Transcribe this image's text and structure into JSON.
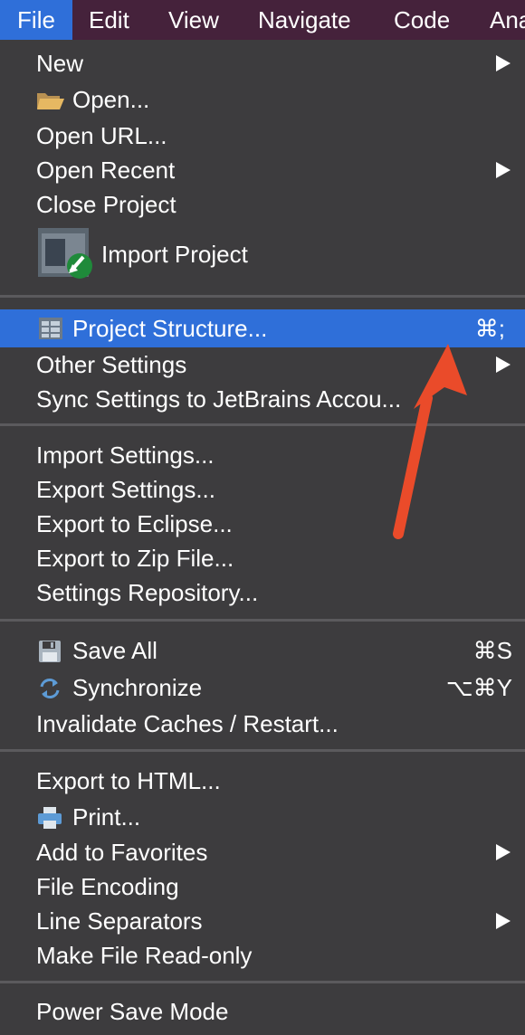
{
  "menubar": {
    "items": [
      {
        "label": "File"
      },
      {
        "label": "Edit"
      },
      {
        "label": "View"
      },
      {
        "label": "Navigate"
      },
      {
        "label": "Code"
      },
      {
        "label": "Ana"
      }
    ]
  },
  "file_menu": {
    "group1": {
      "new": "New",
      "open": "Open...",
      "open_url": "Open URL...",
      "open_recent": "Open Recent",
      "close_project": "Close Project",
      "import_project": "Import Project"
    },
    "group2": {
      "project_structure": "Project Structure...",
      "project_structure_shortcut": "⌘;",
      "other_settings": "Other Settings",
      "sync_settings": "Sync Settings to JetBrains Accou..."
    },
    "group3": {
      "import_settings": "Import Settings...",
      "export_settings": "Export Settings...",
      "export_eclipse": "Export to Eclipse...",
      "export_zip": "Export to Zip File...",
      "settings_repo": "Settings Repository..."
    },
    "group4": {
      "save_all": "Save All",
      "save_all_shortcut": "⌘S",
      "synchronize": "Synchronize",
      "synchronize_shortcut": "⌥⌘Y",
      "invalidate_caches": "Invalidate Caches / Restart..."
    },
    "group5": {
      "export_html": "Export to HTML...",
      "print": "Print...",
      "add_favorites": "Add to Favorites",
      "file_encoding": "File Encoding",
      "line_separators": "Line Separators",
      "read_only": "Make File Read-only"
    },
    "group6": {
      "power_save": "Power Save Mode"
    }
  },
  "colors": {
    "menubar_bg": "#45223b",
    "menu_bg": "#3d3c3e",
    "selection": "#2f6fd9",
    "annotation_arrow": "#ea4b2a"
  },
  "icons": [
    "folder-icon",
    "import-project-icon",
    "project-structure-icon",
    "save-icon",
    "sync-icon",
    "print-icon",
    "submenu-arrow-icon",
    "annotation-arrow"
  ]
}
